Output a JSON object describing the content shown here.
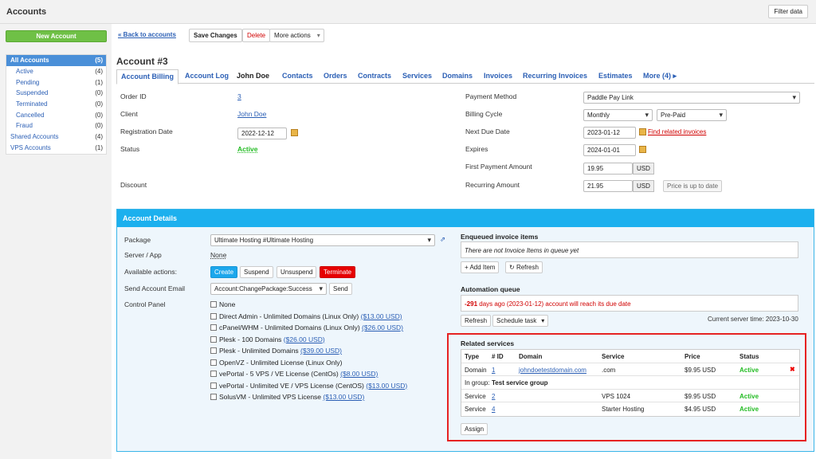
{
  "header": {
    "title": "Accounts",
    "filter": "Filter data"
  },
  "sidebar": {
    "new_button": "New Account",
    "items": [
      {
        "label": "All Accounts",
        "count": "(5)"
      },
      {
        "label": "Active",
        "count": "(4)"
      },
      {
        "label": "Pending",
        "count": "(1)"
      },
      {
        "label": "Suspended",
        "count": "(0)"
      },
      {
        "label": "Terminated",
        "count": "(0)"
      },
      {
        "label": "Cancelled",
        "count": "(0)"
      },
      {
        "label": "Fraud",
        "count": "(0)"
      },
      {
        "label": "Shared Accounts",
        "count": "(4)"
      },
      {
        "label": "VPS Accounts",
        "count": "(1)"
      }
    ]
  },
  "toolbar": {
    "back": "« Back to accounts",
    "save": "Save Changes",
    "delete": "Delete",
    "more": "More actions"
  },
  "page_title": "Account #3",
  "tabs": [
    "Account Billing",
    "Account Log",
    "John Doe",
    "Contacts",
    "Orders",
    "Contracts",
    "Services",
    "Domains",
    "Invoices",
    "Recurring Invoices",
    "Estimates",
    "More (4) ▸"
  ],
  "billing": {
    "order_id_label": "Order ID",
    "order_id": "3",
    "client_label": "Client",
    "client": "John Doe",
    "reg_label": "Registration Date",
    "reg_date": "2022-12-12",
    "status_label": "Status",
    "status": "Active",
    "discount_label": "Discount",
    "payment_method_label": "Payment Method",
    "payment_method": "Paddle Pay Link",
    "billing_cycle_label": "Billing Cycle",
    "billing_cycle": "Monthly",
    "billing_type": "Pre-Paid",
    "next_due_label": "Next Due Date",
    "next_due": "2023-01-12",
    "find_invoices": "Find related invoices",
    "expires_label": "Expires",
    "expires": "2024-01-01",
    "first_payment_label": "First Payment Amount",
    "first_payment": "19.95",
    "recurring_label": "Recurring Amount",
    "recurring": "21.95",
    "currency": "USD",
    "price_status": "Price is up to date"
  },
  "details": {
    "title": "Account Details",
    "package_label": "Package",
    "package": "Ultimate Hosting #Ultimate Hosting",
    "server_label": "Server / App",
    "server": "None",
    "actions_label": "Available actions:",
    "actions": {
      "create": "Create",
      "suspend": "Suspend",
      "unsuspend": "Unsuspend",
      "terminate": "Terminate"
    },
    "email_label": "Send Account Email",
    "email_template": "Account:ChangePackage:Success",
    "send": "Send",
    "cp_label": "Control Panel",
    "control_panels": [
      {
        "name": "None",
        "price": ""
      },
      {
        "name": "Direct Admin - Unlimited Domains (Linux Only)",
        "price": "($13.00 USD)"
      },
      {
        "name": "cPanel/WHM - Unlimited Domains (Linux Only)",
        "price": "($26.00 USD)"
      },
      {
        "name": "Plesk - 100 Domains",
        "price": "($26.00 USD)"
      },
      {
        "name": "Plesk - Unlimited Domains",
        "price": "($39.00 USD)"
      },
      {
        "name": "OpenVZ - Unlimited License (Linux Only)",
        "price": ""
      },
      {
        "name": "vePortal - 5 VPS / VE License (CentOs)",
        "price": "($8.00 USD)"
      },
      {
        "name": "vePortal - Unlimited VE / VPS License (CentOS)",
        "price": "($13.00 USD)"
      },
      {
        "name": "SolusVM - Unlimited VPS License",
        "price": "($13.00 USD)"
      }
    ]
  },
  "enqueued": {
    "title": "Enqueued invoice items",
    "empty": "There are not Invoice Items in queue yet",
    "add": "+ Add Item",
    "refresh": "Refresh"
  },
  "automation": {
    "title": "Automation queue",
    "days": "-291",
    "message": " days ago (2023-01-12) account will reach its due date",
    "refresh": "Refresh",
    "schedule": "Schedule task",
    "server_time": "Current server time: 2023-10-30"
  },
  "related": {
    "title": "Related services",
    "columns": [
      "Type",
      "# ID",
      "Domain",
      "Service",
      "Price",
      "Status"
    ],
    "rows": [
      {
        "type": "Domain",
        "id": "1",
        "domain": "johndoetestdomain.com",
        "service": ".com",
        "price": "$9.95 USD",
        "status": "Active"
      },
      {
        "type": "Service",
        "id": "2",
        "domain": "",
        "service": "VPS 1024",
        "price": "$9.95 USD",
        "status": "Active"
      },
      {
        "type": "Service",
        "id": "4",
        "domain": "",
        "service": "Starter Hosting",
        "price": "$4.95 USD",
        "status": "Active"
      }
    ],
    "group_label": "In group:",
    "group_name": "Test service group",
    "assign": "Assign"
  },
  "colors": {
    "accent": "#1cb0ee",
    "highlight": "#e62222",
    "active_green": "#22bb22",
    "new_button": "#6fc046"
  }
}
